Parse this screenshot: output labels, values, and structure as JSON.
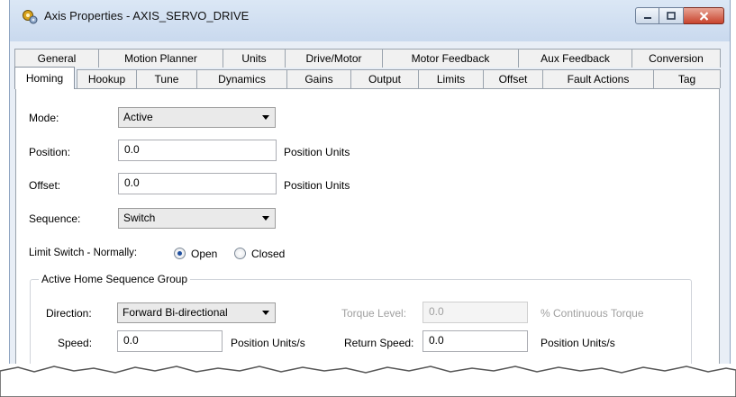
{
  "window": {
    "title": "Axis Properties - AXIS_SERVO_DRIVE",
    "controls": {
      "minimize": "minimize",
      "maximize": "maximize",
      "close": "close"
    }
  },
  "tabs_back": [
    "General",
    "Motion Planner",
    "Units",
    "Drive/Motor",
    "Motor Feedback",
    "Aux Feedback",
    "Conversion"
  ],
  "tabs_front": [
    "Homing",
    "Hookup",
    "Tune",
    "Dynamics",
    "Gains",
    "Output",
    "Limits",
    "Offset",
    "Fault Actions",
    "Tag"
  ],
  "active_tab": "Homing",
  "form": {
    "mode_label": "Mode:",
    "mode_value": "Active",
    "position_label": "Position:",
    "position_value": "0.0",
    "position_units": "Position Units",
    "offset_label": "Offset:",
    "offset_value": "0.0",
    "offset_units": "Position Units",
    "sequence_label": "Sequence:",
    "sequence_value": "Switch",
    "limit_switch_label": "Limit Switch - Normally:",
    "open_label": "Open",
    "closed_label": "Closed",
    "limit_switch_selected": "Open"
  },
  "group": {
    "title": "Active Home Sequence Group",
    "direction_label": "Direction:",
    "direction_value": "Forward Bi-directional",
    "torque_level_label": "Torque Level:",
    "torque_level_value": "0.0",
    "torque_units": "% Continuous Torque",
    "speed_label": "Speed:",
    "speed_value": "0.0",
    "speed_units": "Position Units/s",
    "return_speed_label": "Return Speed:",
    "return_speed_value": "0.0",
    "return_speed_units": "Position Units/s"
  },
  "colors": {
    "titlebar": "#c9d9ee",
    "window_bg": "#e8eef6",
    "close_button": "#c8432d",
    "radio_dot": "#1f4f9e"
  },
  "icons": {
    "app": "gears-icon",
    "minimize": "minimize-icon",
    "maximize": "maximize-icon",
    "close": "close-icon"
  }
}
